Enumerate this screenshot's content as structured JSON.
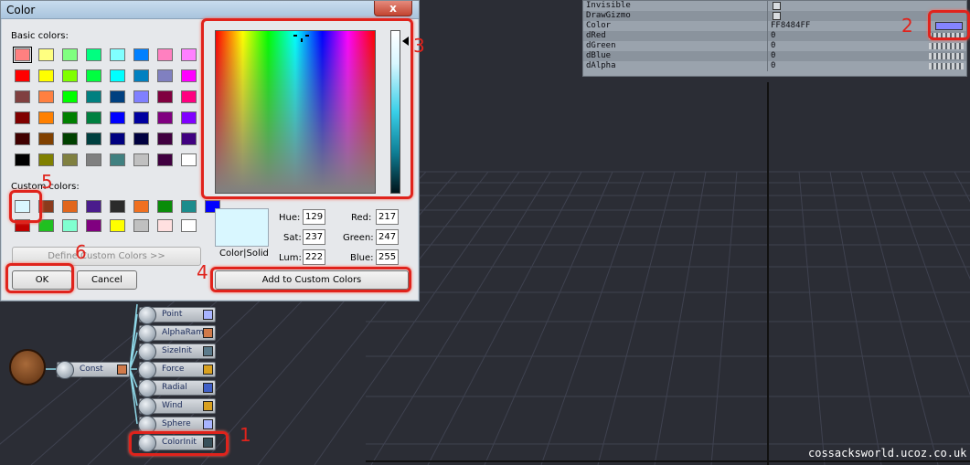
{
  "properties": [
    {
      "name": "Invisible",
      "type": "checkbox"
    },
    {
      "name": "DrawGizmo",
      "type": "checkbox"
    },
    {
      "name": "Color",
      "value": "FF8484FF",
      "type": "color"
    },
    {
      "name": "dRed",
      "value": "0",
      "type": "slider"
    },
    {
      "name": "dGreen",
      "value": "0",
      "type": "slider"
    },
    {
      "name": "dBlue",
      "value": "0",
      "type": "slider"
    },
    {
      "name": "dAlpha",
      "value": "0",
      "type": "slider"
    }
  ],
  "dialog": {
    "title": "Color",
    "close_label": "x",
    "basic_colors_label": "Basic colors:",
    "custom_colors_label": "Custom colors:",
    "define_custom_label": "Define Custom Colors >>",
    "ok_label": "OK",
    "cancel_label": "Cancel",
    "add_custom_label": "Add to Custom Colors",
    "color_solid_label": "Color|Solid",
    "hue_label": "Hue:",
    "hue_value": "129",
    "sat_label": "Sat:",
    "sat_value": "237",
    "lum_label": "Lum:",
    "lum_value": "222",
    "red_label": "Red:",
    "red_value": "217",
    "green_label": "Green:",
    "green_value": "247",
    "blue_label": "Blue:",
    "blue_value": "255",
    "basic_colors": [
      [
        "#ff8080",
        "#ffff80",
        "#80ff80",
        "#00ff80",
        "#80ffff",
        "#0080ff",
        "#ff80c0",
        "#ff80ff"
      ],
      [
        "#ff0000",
        "#ffff00",
        "#80ff00",
        "#00ff40",
        "#00ffff",
        "#0080c0",
        "#8080c0",
        "#ff00ff"
      ],
      [
        "#804040",
        "#ff8040",
        "#00ff00",
        "#008080",
        "#004080",
        "#8080ff",
        "#800040",
        "#ff0080"
      ],
      [
        "#800000",
        "#ff8000",
        "#008000",
        "#008040",
        "#0000ff",
        "#0000a0",
        "#800080",
        "#8000ff"
      ],
      [
        "#400000",
        "#804000",
        "#004000",
        "#004040",
        "#000080",
        "#000040",
        "#400040",
        "#400080"
      ],
      [
        "#000000",
        "#808000",
        "#808040",
        "#808080",
        "#408080",
        "#c0c0c0",
        "#400040",
        "#ffffff"
      ]
    ],
    "custom_colors": [
      [
        "#d9f7ff",
        "#8b3a1c",
        "#e1661c",
        "#4a1c8c",
        "#2b2b2b",
        "#f07020",
        "#0a8c0a",
        "#1c8c8c",
        "#0000ff"
      ],
      [
        "#c00000",
        "#20c020",
        "#80ffd0",
        "#800080",
        "#ffff00",
        "#c0c0c0",
        "#ffe0e0",
        "#ffffff"
      ]
    ],
    "preview_color": "#d9f7ff"
  },
  "nodes": [
    {
      "label": "Point",
      "port_color": "#a8b4ff"
    },
    {
      "label": "AlphaRamp",
      "port_color": "#d07a4a"
    },
    {
      "label": "SizeInit",
      "port_color": "#5b7a8a"
    },
    {
      "label": "Force",
      "port_color": "#d8a020"
    },
    {
      "label": "Radial",
      "port_color": "#4060c8"
    },
    {
      "label": "Wind",
      "port_color": "#d8a020"
    },
    {
      "label": "Sphere",
      "port_color": "#a8b4ff"
    },
    {
      "label": "ColorInit",
      "port_color": "#38505a"
    }
  ],
  "const_node": {
    "label": "Const",
    "port_color": "#d07a4a"
  },
  "annotations": [
    "1",
    "2",
    "3",
    "4",
    "5",
    "6"
  ],
  "watermark": "cossacksworld.ucoz.co.uk"
}
